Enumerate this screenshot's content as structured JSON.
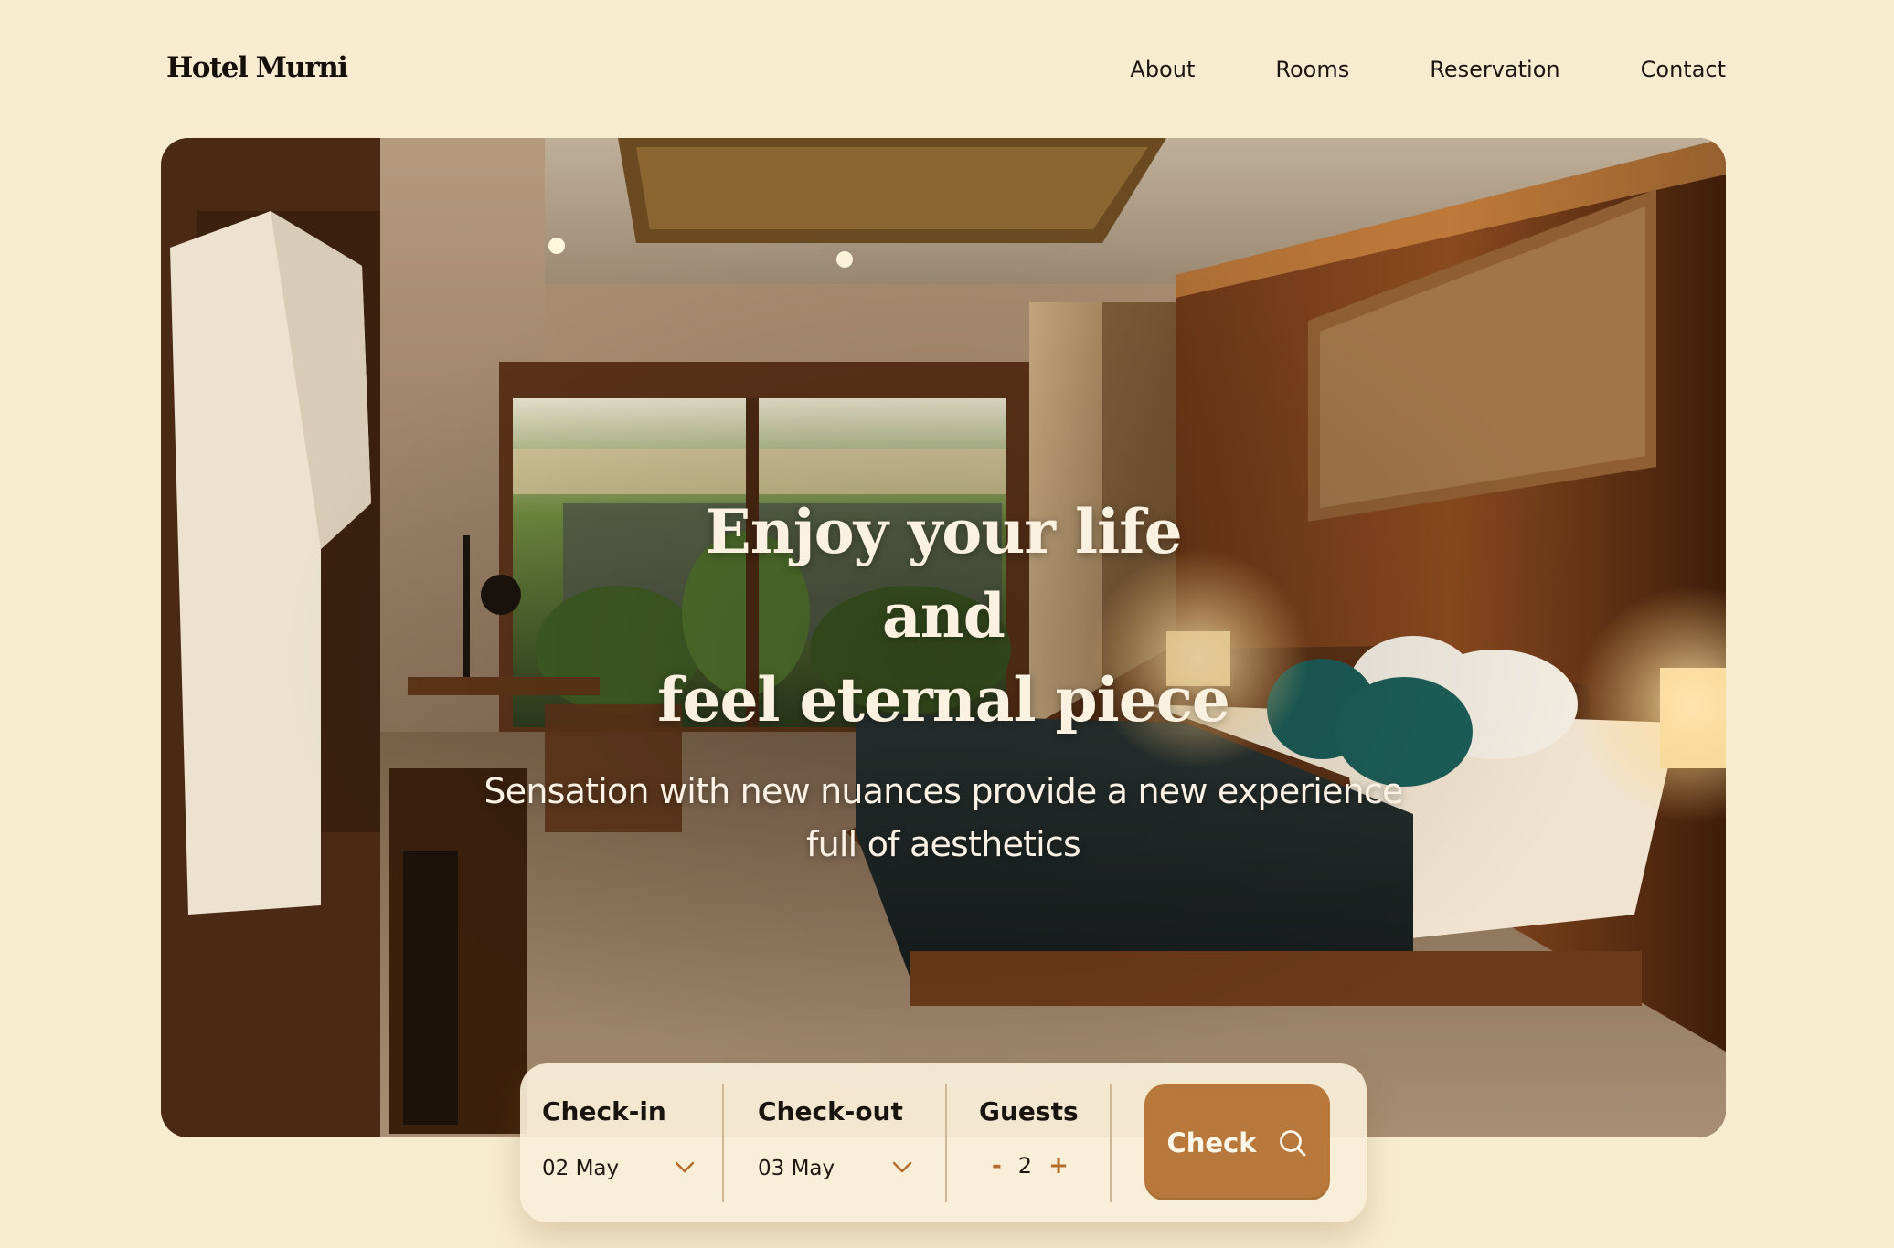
{
  "brand": {
    "name": "Hotel Murni"
  },
  "nav": {
    "items": [
      {
        "label": "About"
      },
      {
        "label": "Rooms"
      },
      {
        "label": "Reservation"
      },
      {
        "label": "Contact"
      }
    ]
  },
  "hero": {
    "title_lines": [
      "Enjoy your life",
      "and",
      "feel eternal piece"
    ],
    "subtitle_lines": [
      "Sensation with new nuances provide a new experience",
      "full of aesthetics"
    ],
    "image": "hotel-bedroom-photo"
  },
  "booking": {
    "checkin": {
      "label": "Check-in",
      "value": "02 May",
      "icon": "chevron-down-icon"
    },
    "checkout": {
      "label": "Check-out",
      "value": "03 May",
      "icon": "chevron-down-icon"
    },
    "guests": {
      "label": "Guests",
      "value": "2",
      "decrement": "-",
      "increment": "+"
    },
    "submit": {
      "label": "Check",
      "icon": "search-icon"
    }
  },
  "colors": {
    "background": "#f8ecd0",
    "accent": "#b8773b",
    "text": "#1b1410"
  }
}
